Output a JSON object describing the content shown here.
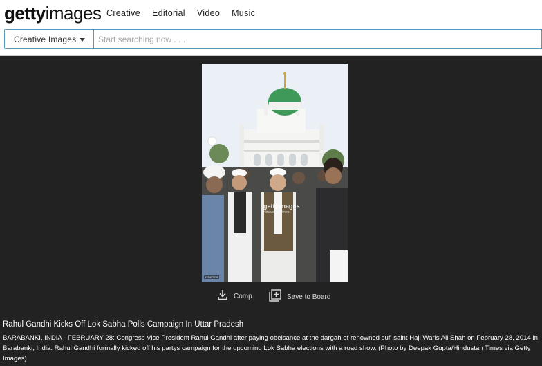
{
  "header": {
    "logo_bold": "getty",
    "logo_light": "images",
    "nav": [
      "Creative",
      "Editorial",
      "Video",
      "Music"
    ]
  },
  "search": {
    "dropdown_label": "Creative Images",
    "placeholder": "Start searching now . . ."
  },
  "photo": {
    "watermark": "gettyimages",
    "watermark_sub": "Hindustan Times",
    "id_label": "473477720"
  },
  "actions": {
    "comp_label": "Comp",
    "save_label": "Save to Board"
  },
  "caption": {
    "title": "Rahul Gandhi Kicks Off Lok Sabha Polls Campaign In Uttar Pradesh",
    "description": "BARABANKI, INDIA - FEBRUARY 28: Congress Vice President Rahul Gandhi after paying obeisance at the dargah of renowned sufi saint Haji Waris Ali Shah on February 28, 2014 in Barabanki, India. Rahul Gandhi formally kicked off his partys campaign for the upcoming Lok Sabha elections with a road show. (Photo by Deepak Gupta/Hindustan Times via Getty Images)"
  },
  "colors": {
    "page_bg": "#222222",
    "header_bg": "#ffffff",
    "accent_border": "#5a9ab8",
    "dome_green": "#3f9a5a"
  }
}
